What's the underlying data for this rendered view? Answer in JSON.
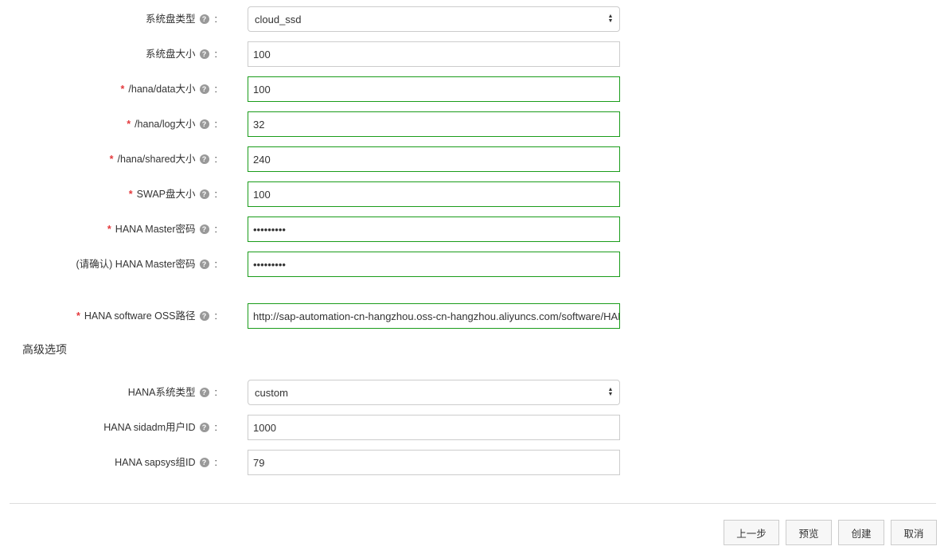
{
  "form": {
    "system_disk_type": {
      "label": "系统盘类型",
      "value": "cloud_ssd"
    },
    "system_disk_size": {
      "label": "系统盘大小",
      "value": "100"
    },
    "hana_data_size": {
      "label": "/hana/data大小",
      "value": "100",
      "required": "*"
    },
    "hana_log_size": {
      "label": "/hana/log大小",
      "value": "32",
      "required": "*"
    },
    "hana_shared_size": {
      "label": "/hana/shared大小",
      "value": "240",
      "required": "*"
    },
    "swap_size": {
      "label": "SWAP盘大小",
      "value": "100",
      "required": "*"
    },
    "hana_master_password": {
      "label": "HANA Master密码",
      "value": "abcdefghi",
      "required": "*"
    },
    "hana_master_password_confirm": {
      "label": "(请确认) HANA Master密码",
      "value": "abcdefghi"
    },
    "hana_software_oss_path": {
      "label": "HANA software OSS路径",
      "value": "http://sap-automation-cn-hangzhou.oss-cn-hangzhou.aliyuncs.com/software/HANA",
      "required": "*"
    }
  },
  "advanced": {
    "title": "高级选项",
    "hana_system_type": {
      "label": "HANA系统类型",
      "value": "custom"
    },
    "hana_sidadm_uid": {
      "label": "HANA sidadm用户ID",
      "value": "1000"
    },
    "hana_sapsys_gid": {
      "label": "HANA sapsys组ID",
      "value": "79"
    }
  },
  "common": {
    "colon": ":",
    "help": "?"
  },
  "actions": {
    "prev": "上一步",
    "preview": "预览",
    "create": "创建",
    "cancel": "取消"
  },
  "colors": {
    "valid_border": "#1a9c1a",
    "required_mark": "#e4393c"
  }
}
